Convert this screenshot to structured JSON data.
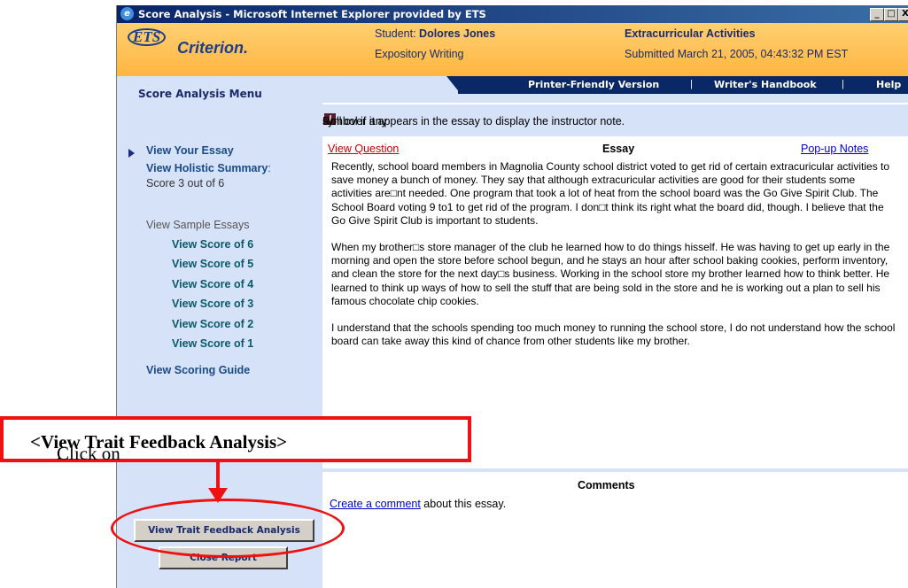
{
  "window": {
    "title": "Score Analysis - Microsoft Internet Explorer provided by ETS",
    "controls": {
      "minimize": "_",
      "maximize": "□",
      "close": "X"
    }
  },
  "header": {
    "logo_ets": "ETS",
    "logo_criterion": "Criterion.",
    "student_label": "Student: ",
    "student_name": "Dolores Jones",
    "mode": "Expository Writing",
    "topic": "Extracurricular Activities",
    "submitted": "Submitted March 21, 2005, 04:43:32 PM EST"
  },
  "nav": {
    "menu_title": "Score Analysis Menu",
    "printer_friendly": "Printer-Friendly Version",
    "writers_handbook": "Writer's Handbook",
    "help": "Help",
    "separator": "|"
  },
  "instruction": {
    "before": "Roll over any ",
    "icon": "I",
    "after": " symbol if it appears in the essay to display the instructor note."
  },
  "sidebar": {
    "view_essay": "View Your Essay",
    "holistic_label": "View Holistic Summary",
    "holistic_colon": ":",
    "holistic_score": "Score 3 out of 6",
    "sample_label": "View Sample Essays",
    "scores": [
      "View Score of 6",
      "View Score of 5",
      "View Score of 4",
      "View Score of 3",
      "View Score of 2",
      "View Score of 1"
    ],
    "scoring_guide": "View Scoring Guide",
    "trait_button": "View Trait Feedback Analysis",
    "close_button": "Close Report"
  },
  "essay": {
    "view_question": "View Question",
    "heading": "Essay",
    "popup_notes": "Pop-up Notes",
    "paragraphs": [
      "Recently, school board members in Magnolia County school district voted to get rid of certain extracuricular activities to save money a bunch of money. They say that although extracuricular activities are good for their students some activities are□nt needed. One program that took a lot of heat from the school board was the Go Give Spirit Club. The School Board voting 9 to1 to get rid of the program. I don□t think its right what the board did, though. I believe that the Go Give Spirit Club is important to students.",
      "When my brother□s store manager of the club he learned how to do things hisself. He was having to get up early in the morning and open the store before school begun, and he stays an hour after school baking cookies, perform inventory, and clean the store for the next day□s business. Working in the school store my brother learned how to think better. He learned to think up ways of how to sell the stuff that are being sold in the store and he is working out a plan to sell his famous chocolate chip cookies.",
      "I understand that the schools spending too much money to running the school store, I do not understand how the school board can take away this kind of chance from other students like my brother."
    ]
  },
  "comments": {
    "heading": "Comments",
    "link": "Create a comment",
    "suffix": " about this essay."
  },
  "callout": {
    "prefix": "Click on ",
    "bold": "<View Trait Feedback Analysis>",
    "suffix": "."
  },
  "colors": {
    "title_bar": "#0a246a",
    "header_orange": "#ffb640",
    "nav_navy": "#0a2866",
    "sidebar_blue": "#d6e2f7",
    "annotation_red": "#e11"
  }
}
